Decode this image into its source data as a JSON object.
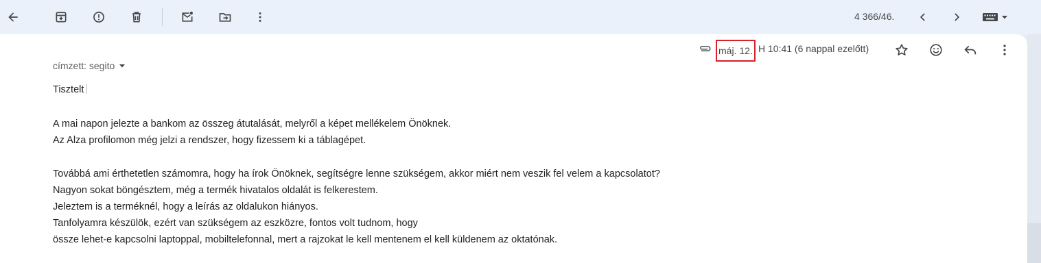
{
  "toolbar": {
    "back_icon": "arrow-left-icon",
    "archive_icon": "archive-icon",
    "spam_icon": "report-spam-icon",
    "delete_icon": "trash-icon",
    "unread_icon": "mark-unread-icon",
    "move_icon": "move-to-icon",
    "more_icon": "more-vert-icon",
    "pager_text": "4 366/46.",
    "prev_icon": "chevron-left-icon",
    "next_icon": "chevron-right-icon",
    "keyboard_icon": "keyboard-icon"
  },
  "message": {
    "attachment_icon": "paperclip-icon",
    "date_highlight": "máj. 12.",
    "date_rest": "H 10:41 (6 nappal ezelőtt)",
    "actions": {
      "star_icon": "star-icon",
      "emoji_icon": "emoji-icon",
      "reply_icon": "reply-icon",
      "more_icon": "more-vert-icon"
    },
    "recipient_label": "címzett: segito",
    "body": [
      "Tisztelt",
      "A mai napon jelezte a bankom az összeg átutalását, melyről a képet mellékelem Önöknek.",
      "Az Alza profilomon még jelzi a rendszer, hogy fizessem ki a táblagépet.",
      "Továbbá ami érthetetlen számomra, hogy ha írok Önöknek, segítségre lenne szükségem, akkor miért nem veszik fel velem a kapcsolatot?",
      "Nagyon sokat böngésztem, még a termék hivatalos oldalát is felkerestem.",
      "Jeleztem is a terméknél, hogy a leírás az oldalukon hiányos.",
      "Tanfolyamra készülök, ezért van szükségem az eszközre, fontos volt tudnom, hogy",
      "össze lehet-e kapcsolni laptoppal, mobiltelefonnal, mert a rajzokat le kell mentenem el kell küldenem az oktatónak."
    ]
  },
  "colors": {
    "toolbar_bg": "#eaf1fb",
    "highlight_border": "#d8202a",
    "icon": "#444746"
  }
}
